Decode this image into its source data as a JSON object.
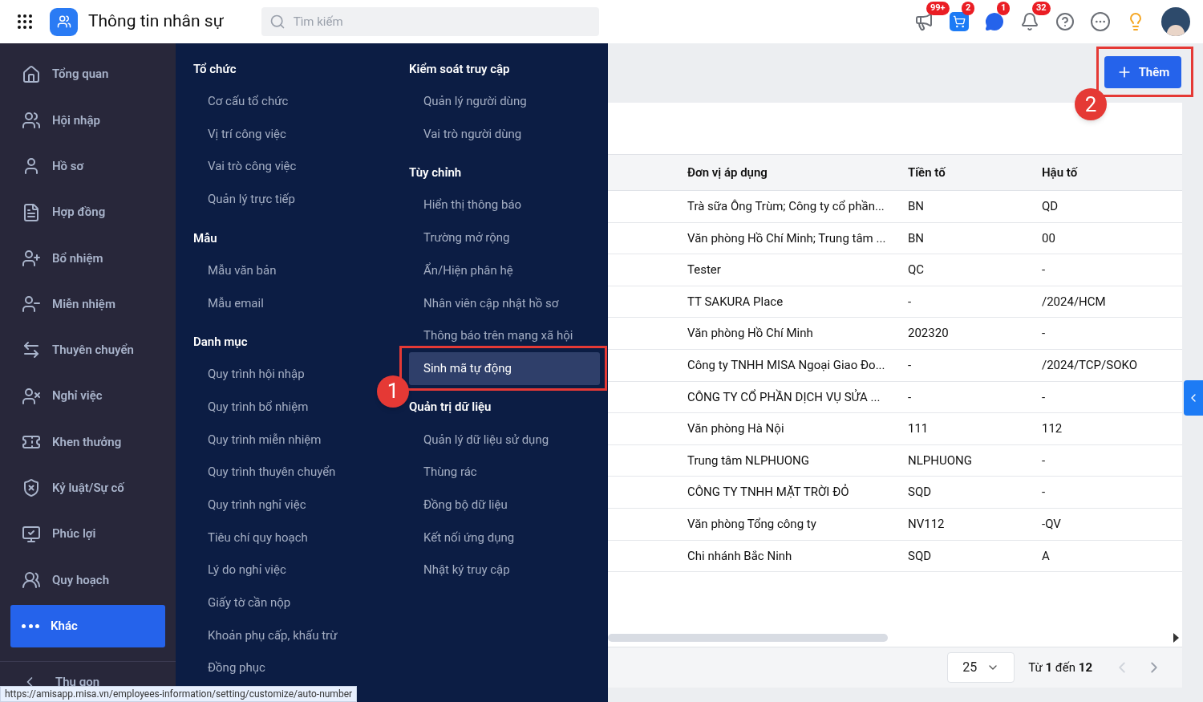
{
  "header": {
    "app_title": "Thông tin nhân sự",
    "search": {
      "placeholder": "Tìm kiếm"
    },
    "badges": [
      "99+",
      "2",
      "1",
      "32"
    ]
  },
  "sidebar": {
    "items": [
      {
        "label": "Tổng quan",
        "selected": false
      },
      {
        "label": "Hội nhập",
        "selected": false
      },
      {
        "label": "Hồ sơ",
        "selected": false
      },
      {
        "label": "Hợp đồng",
        "selected": false
      },
      {
        "label": "Bổ nhiệm",
        "selected": false
      },
      {
        "label": "Miễn nhiệm",
        "selected": false
      },
      {
        "label": "Thuyên chuyển",
        "selected": false
      },
      {
        "label": "Nghỉ việc",
        "selected": false
      },
      {
        "label": "Khen thưởng",
        "selected": false
      },
      {
        "label": "Kỷ luật/Sự cố",
        "selected": false
      },
      {
        "label": "Phúc lợi",
        "selected": false
      },
      {
        "label": "Quy hoạch",
        "selected": false
      },
      {
        "label": "Khác",
        "selected": true
      }
    ],
    "collapse": "Thu gọn"
  },
  "menu": {
    "columns": [
      [
        {
          "title": "Tổ chức",
          "items": [
            {
              "label": "Cơ cấu tổ chức",
              "selected": false
            },
            {
              "label": "Vị trí công việc",
              "selected": false
            },
            {
              "label": "Vai trò công việc",
              "selected": false
            },
            {
              "label": "Quản lý trực tiếp",
              "selected": false
            }
          ]
        },
        {
          "title": "Mẫu",
          "items": [
            {
              "label": "Mẫu văn bản",
              "selected": false
            },
            {
              "label": "Mẫu email",
              "selected": false
            }
          ]
        },
        {
          "title": "Danh mục",
          "items": [
            {
              "label": "Quy trình hội nhập",
              "selected": false
            },
            {
              "label": "Quy trình bổ nhiệm",
              "selected": false
            },
            {
              "label": "Quy trình miễn nhiệm",
              "selected": false
            },
            {
              "label": "Quy trình thuyên chuyển",
              "selected": false
            },
            {
              "label": "Quy trình nghỉ việc",
              "selected": false
            },
            {
              "label": "Tiêu chí quy hoạch",
              "selected": false
            },
            {
              "label": "Lý do nghỉ việc",
              "selected": false
            },
            {
              "label": "Giấy tờ cần nộp",
              "selected": false
            },
            {
              "label": "Khoản phụ cấp, khấu trừ",
              "selected": false
            },
            {
              "label": "Đồng phục",
              "selected": false
            }
          ]
        }
      ],
      [
        {
          "title": "Kiểm soát truy cập",
          "items": [
            {
              "label": "Quản lý người dùng",
              "selected": false
            },
            {
              "label": "Vai trò người dùng",
              "selected": false
            }
          ]
        },
        {
          "title": "Tùy chỉnh",
          "items": [
            {
              "label": "Hiển thị thông báo",
              "selected": false
            },
            {
              "label": "Trường mở rộng",
              "selected": false
            },
            {
              "label": "Ẩn/Hiện phân hệ",
              "selected": false
            },
            {
              "label": "Nhân viên cập nhật hồ sơ",
              "selected": false
            },
            {
              "label": "Thông báo trên mạng xã hội",
              "selected": false
            },
            {
              "label": "Sinh mã tự động",
              "selected": true,
              "callout": "1"
            }
          ]
        },
        {
          "title": "Quản trị dữ liệu",
          "items": [
            {
              "label": "Quản lý dữ liệu sử dụng",
              "selected": false
            },
            {
              "label": "Thùng rác",
              "selected": false
            },
            {
              "label": "Đồng bộ dữ liệu",
              "selected": false
            },
            {
              "label": "Kết nối ứng dụng",
              "selected": false
            },
            {
              "label": "Nhật ký truy cập",
              "selected": false
            }
          ]
        }
      ]
    ]
  },
  "page": {
    "add_button": {
      "label": "Thêm",
      "callout": "2"
    },
    "table": {
      "columns": [
        "Đơn vị áp dụng",
        "Tiền tố",
        "Hậu tố"
      ],
      "rows": [
        [
          "Trà sữa Ông Trùm; Công ty cổ phần...",
          "BN",
          "QD"
        ],
        [
          "Văn phòng Hồ Chí Minh; Trung tâm ...",
          "BN",
          "00"
        ],
        [
          "Tester",
          "QC",
          "-"
        ],
        [
          "TT SAKURA Place",
          "-",
          "/2024/HCM"
        ],
        [
          "Văn phòng Hồ Chí Minh",
          "202320",
          "-"
        ],
        [
          "Công ty TNHH MISA Ngoại Giao Đo...",
          "-",
          "/2024/TCP/SOKO"
        ],
        [
          "CÔNG TY CỔ PHẦN DỊCH VỤ SỬA ...",
          "-",
          "-"
        ],
        [
          "Văn phòng Hà Nội",
          "111",
          "112"
        ],
        [
          "Trung tâm NLPHUONG",
          "NLPHUONG",
          "-"
        ],
        [
          "CÔNG TY TNHH MẶT TRỜI ĐỎ",
          "SQD",
          "-"
        ],
        [
          "Văn phòng Tổng công ty",
          "NV112",
          "-QV"
        ],
        [
          "Chi nhánh Bắc Ninh",
          "SQD",
          "A"
        ]
      ]
    },
    "pagination": {
      "page_size": "25",
      "range": "Từ **1** đến **12**",
      "prev_disabled": true,
      "next_disabled": false
    }
  },
  "status_url": "https://amisapp.misa.vn/employees-information/setting/customize/auto-number"
}
